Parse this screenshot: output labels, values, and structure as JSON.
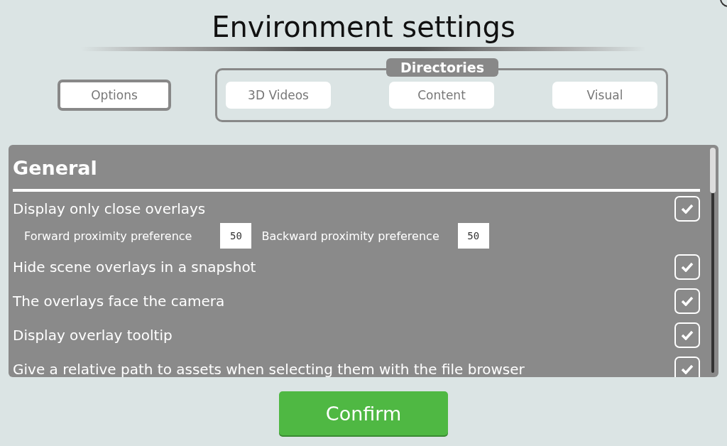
{
  "window": {
    "title": "Environment settings"
  },
  "tabs": [
    {
      "label": "Options",
      "selected": true
    }
  ],
  "tab_group": {
    "label": "Directories",
    "tabs": [
      {
        "label": "3D Videos",
        "selected": false
      },
      {
        "label": "Content",
        "selected": false
      },
      {
        "label": "Visual",
        "selected": false
      }
    ]
  },
  "section": {
    "title": "General"
  },
  "settings": [
    {
      "kind": "checkbox",
      "label": "Display only close overlays",
      "checked": true
    },
    {
      "kind": "numbers",
      "fields": [
        {
          "label": "Forward proximity preference",
          "value": "50"
        },
        {
          "label": "Backward proximity preference",
          "value": "50"
        }
      ]
    },
    {
      "kind": "checkbox",
      "label": "Hide scene overlays in a snapshot",
      "checked": true
    },
    {
      "kind": "checkbox",
      "label": "The overlays face the camera",
      "checked": true
    },
    {
      "kind": "checkbox",
      "label": "Display overlay tooltip",
      "checked": true
    },
    {
      "kind": "checkbox",
      "label": "Give a relative path to assets when selecting them with the file browser",
      "checked": true
    }
  ],
  "confirm": {
    "label": "Confirm"
  }
}
